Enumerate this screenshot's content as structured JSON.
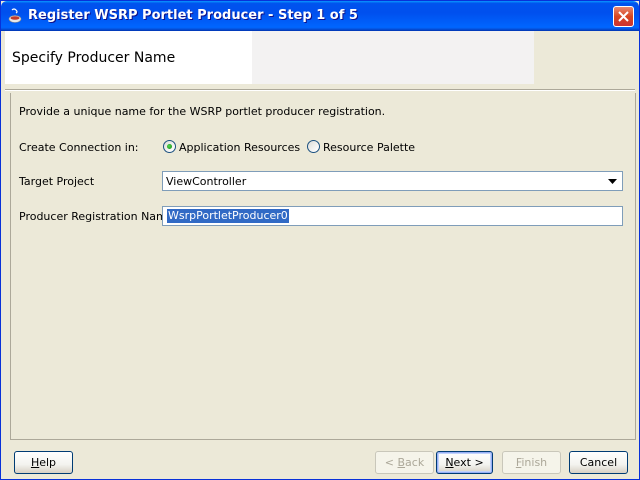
{
  "window": {
    "title": "Register WSRP Portlet Producer - Step 1 of 5",
    "title_icon": "oracle-cup-icon",
    "close_icon": "close-icon"
  },
  "header": {
    "title": "Specify Producer Name"
  },
  "form": {
    "description": "Provide a unique name for the WSRP portlet producer registration.",
    "create_connection": {
      "label": "Create Connection in:",
      "options": [
        {
          "label": "Application Resources",
          "selected": true
        },
        {
          "label": "Resource Palette",
          "selected": false
        }
      ]
    },
    "target_project": {
      "label": "Target Project",
      "value": "ViewController"
    },
    "producer_name": {
      "label": "Producer Registration Name:",
      "value": "WsrpPortletProducer0"
    }
  },
  "buttons": {
    "help": {
      "pre": "",
      "mnemonic": "H",
      "post": "elp"
    },
    "back": {
      "pre": "< ",
      "mnemonic": "B",
      "post": "ack"
    },
    "next": {
      "pre": "",
      "mnemonic": "N",
      "post": "ext >"
    },
    "finish": {
      "pre": "",
      "mnemonic": "F",
      "post": "inish"
    },
    "cancel": {
      "label": "Cancel"
    }
  },
  "colors": {
    "titlebar": "#0054e3",
    "selection": "#316ac5",
    "dialog_bg": "#ece9d8"
  }
}
